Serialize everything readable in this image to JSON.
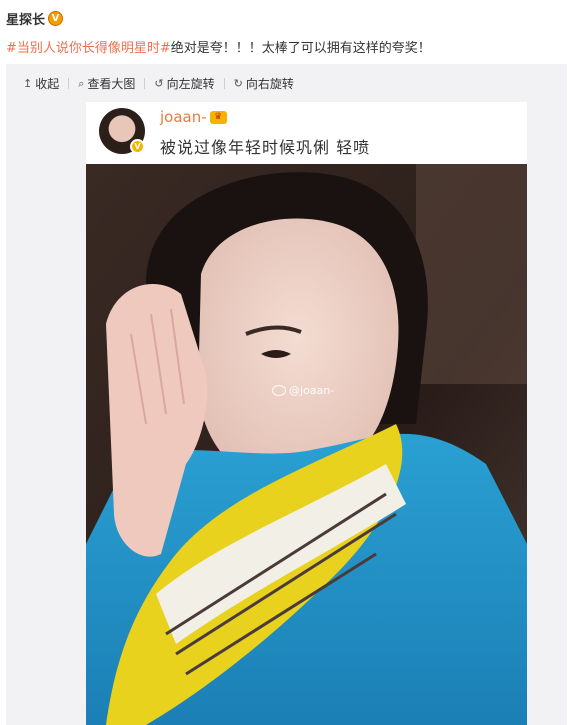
{
  "post": {
    "author": "星探长",
    "verified_badge": "V",
    "hashtag": "#当别人说你长得像明星时#",
    "text": "绝对是夸！！！太棒了可以拥有这样的夸奖！"
  },
  "toolbar": {
    "collapse": {
      "icon": "up-arrow-icon",
      "glyph": "↥",
      "label": "收起"
    },
    "view_large": {
      "icon": "magnifier-icon",
      "glyph": "⌕",
      "label": "查看大图"
    },
    "rotate_left": {
      "icon": "rotate-left-icon",
      "glyph": "↺",
      "label": "向左旋转"
    },
    "rotate_right": {
      "icon": "rotate-right-icon",
      "glyph": "↻",
      "label": "向右旋转"
    }
  },
  "picture": {
    "username": "joaan-",
    "crown_glyph": "♛",
    "avatar_badge": "V",
    "caption": "被说过像年轻时候巩俐  轻喷",
    "watermark": "@joaan-"
  },
  "colors": {
    "hashtag": "#eb7350",
    "username": "#e77c3a",
    "media_bg": "#f2f2f5",
    "jacket": "#1f8fc4",
    "scarf": "#e8d21e"
  }
}
